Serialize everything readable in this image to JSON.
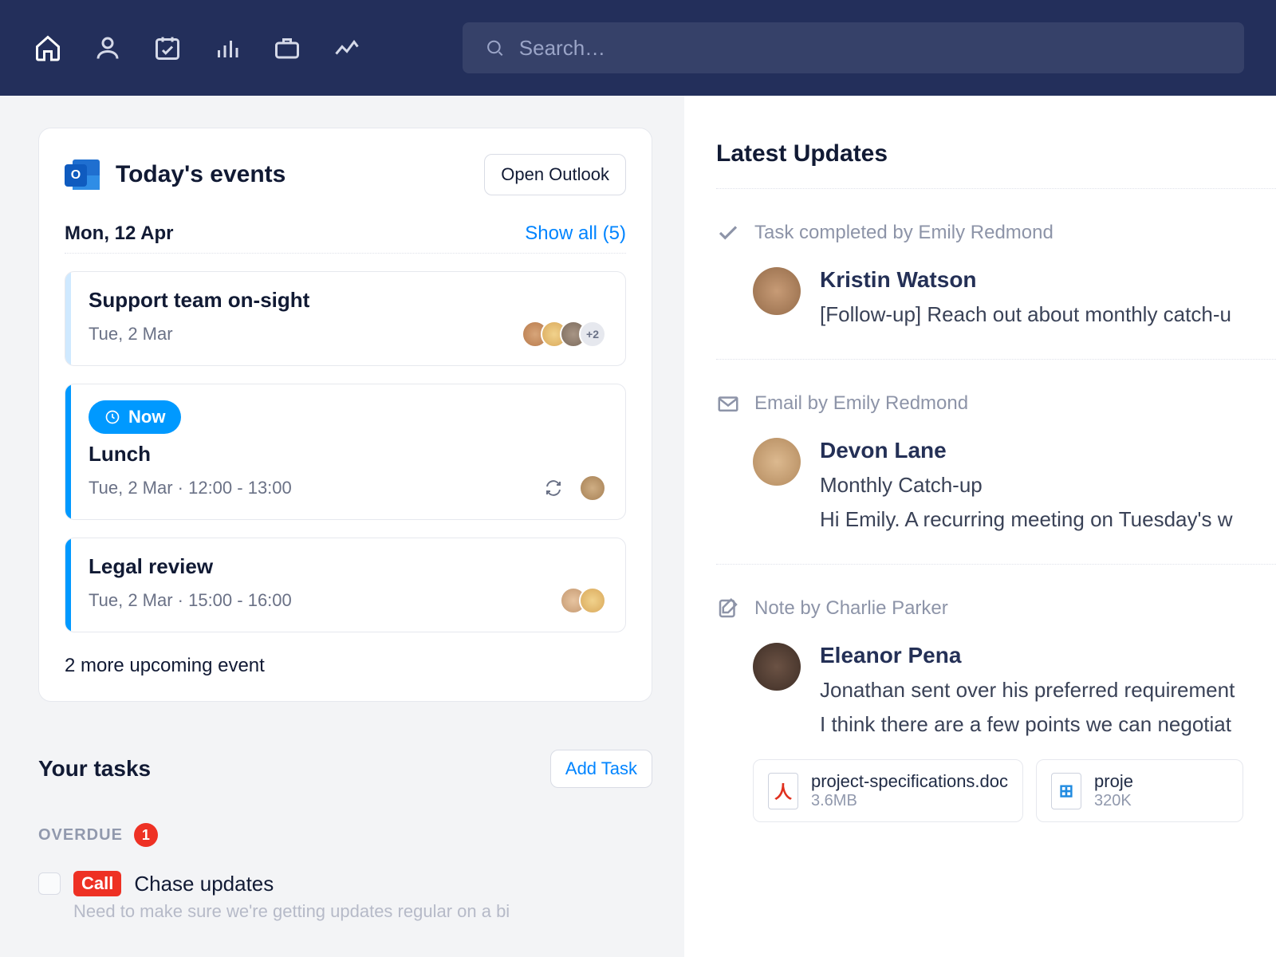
{
  "nav": {
    "search_placeholder": "Search…"
  },
  "events_card": {
    "title": "Today's events",
    "open_button": "Open Outlook",
    "date": "Mon, 12 Apr",
    "show_all": "Show all (5)",
    "more": "2 more upcoming event",
    "now_label": "Now",
    "items": [
      {
        "title": "Support team on-sight",
        "sub": "Tue, 2 Mar",
        "extra_count": "+2"
      },
      {
        "title": "Lunch",
        "sub": "Tue, 2 Mar · 12:00 - 13:00"
      },
      {
        "title": "Legal review",
        "sub": "Tue, 2 Mar · 15:00 - 16:00"
      }
    ]
  },
  "tasks": {
    "title": "Your tasks",
    "add_button": "Add Task",
    "overdue_label": "OVERDUE",
    "overdue_count": "1",
    "items": [
      {
        "tag": "Call",
        "title": "Chase updates",
        "note": "Need to make sure we're getting updates regular on a bi"
      }
    ]
  },
  "updates": {
    "title": "Latest Updates",
    "items": [
      {
        "type_label": "Task completed by Emily Redmond",
        "name": "Kristin Watson",
        "lines": [
          "[Follow-up] Reach out about monthly catch-u"
        ]
      },
      {
        "type_label": "Email by Emily Redmond",
        "name": "Devon Lane",
        "lines": [
          "Monthly Catch-up",
          "Hi Emily. A recurring meeting on Tuesday's w"
        ]
      },
      {
        "type_label": "Note by Charlie Parker",
        "name": "Eleanor Pena",
        "lines": [
          "Jonathan sent over his preferred requirement",
          "I think there are a few points we can negotiat"
        ]
      }
    ],
    "attachments": [
      {
        "name": "project-specifications.doc",
        "size": "3.6MB",
        "kind": "pdf"
      },
      {
        "name": "proje",
        "size": "320K",
        "kind": "sheet"
      }
    ]
  }
}
